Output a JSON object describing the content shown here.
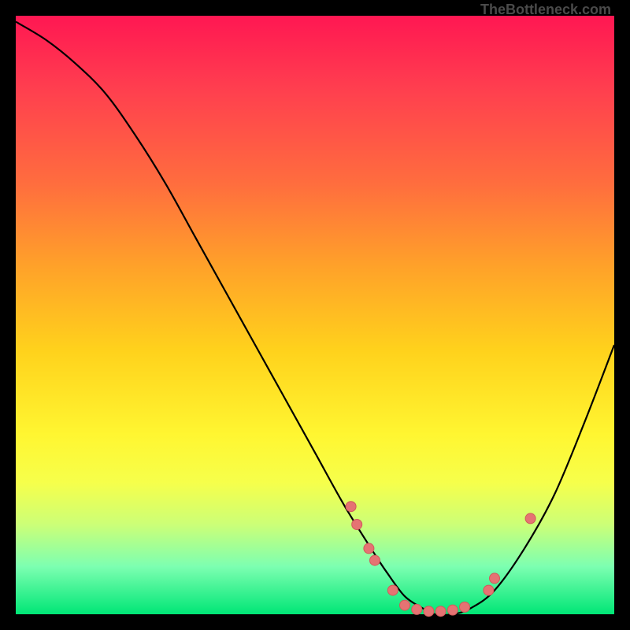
{
  "attribution": "TheBottleneck.com",
  "colors": {
    "gradient_top": "#ff1752",
    "gradient_mid": "#ffd21c",
    "gradient_bottom": "#00e676",
    "curve": "#000000",
    "marker_fill": "#e57373",
    "marker_stroke": "#d15a5a",
    "frame": "#000000"
  },
  "chart_data": {
    "type": "line",
    "title": "",
    "xlabel": "",
    "ylabel": "",
    "xlim": [
      0,
      100
    ],
    "ylim": [
      0,
      100
    ],
    "grid": false,
    "legend": false,
    "curve_note": "y plotted downward = higher value (bottleneck curve, 0 at bottom)",
    "series": [
      {
        "name": "bottleneck-curve",
        "x": [
          0,
          5,
          10,
          15,
          20,
          25,
          30,
          35,
          40,
          45,
          50,
          55,
          60,
          62,
          65,
          68,
          70,
          73,
          76,
          80,
          85,
          90,
          95,
          100
        ],
        "y": [
          99,
          96,
          92,
          87,
          80,
          72,
          63,
          54,
          45,
          36,
          27,
          18,
          10,
          7,
          3,
          1,
          0,
          0,
          1,
          4,
          11,
          20,
          32,
          45
        ]
      }
    ],
    "markers": [
      {
        "x": 56,
        "y": 18
      },
      {
        "x": 57,
        "y": 15
      },
      {
        "x": 59,
        "y": 11
      },
      {
        "x": 60,
        "y": 9
      },
      {
        "x": 63,
        "y": 4
      },
      {
        "x": 65,
        "y": 1.5
      },
      {
        "x": 67,
        "y": 0.8
      },
      {
        "x": 69,
        "y": 0.5
      },
      {
        "x": 71,
        "y": 0.5
      },
      {
        "x": 73,
        "y": 0.7
      },
      {
        "x": 75,
        "y": 1.2
      },
      {
        "x": 79,
        "y": 4
      },
      {
        "x": 80,
        "y": 6
      },
      {
        "x": 86,
        "y": 16
      }
    ]
  }
}
